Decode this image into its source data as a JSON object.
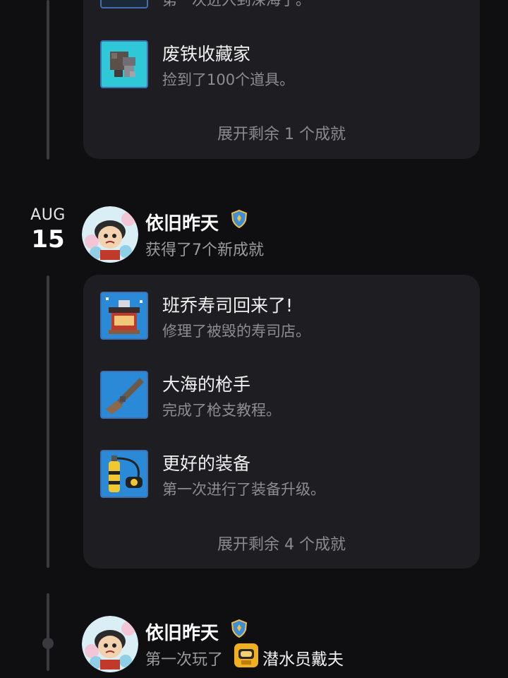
{
  "colors": {
    "background": "#0f0f11",
    "card": "#1e1e22",
    "title_text": "#f0f0f0",
    "secondary_text": "#8d8d92",
    "timeline": "#3a3a3e",
    "icon_cyan": "#2ec8d8",
    "icon_blue": "#2a8ad8"
  },
  "top_card": {
    "partial_desc": "第一次进入到深海了。",
    "achievements": [
      {
        "title": "废铁收藏家",
        "desc": "捡到了100个道具。",
        "icon": "scrap-metal-icon"
      }
    ],
    "expand_label": "展开剩余 1 个成就"
  },
  "entry": {
    "month": "AUG",
    "day": "15",
    "username": "依旧昨天",
    "badge": "shield-badge-icon",
    "subtitle": "获得了7个新成就",
    "achievements": [
      {
        "title": "班乔寿司回来了!",
        "desc": "修理了被毁的寿司店。",
        "icon": "sushi-shop-icon"
      },
      {
        "title": "大海的枪手",
        "desc": "完成了枪支教程。",
        "icon": "harpoon-gun-icon"
      },
      {
        "title": "更好的装备",
        "desc": "第一次进行了装备升级。",
        "icon": "diving-tank-icon"
      }
    ],
    "expand_label": "展开剩余 4 个成就"
  },
  "bottom_entry": {
    "username": "依旧昨天",
    "badge": "shield-badge-icon",
    "subtitle_prefix": "第一次玩了",
    "game_name": "潜水员戴夫",
    "game_icon": "dave-the-diver-icon"
  }
}
